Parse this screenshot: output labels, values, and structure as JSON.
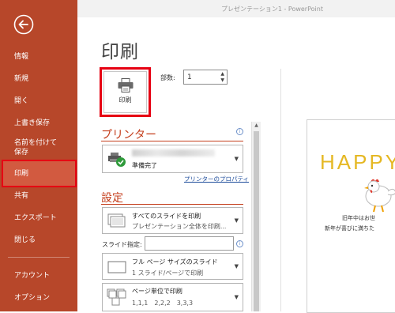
{
  "window": {
    "title": "プレゼンテーション1 - PowerPoint"
  },
  "sidebar": {
    "back_label": "戻る",
    "items": [
      {
        "label": "情報"
      },
      {
        "label": "新規"
      },
      {
        "label": "開く"
      },
      {
        "label": "上書き保存"
      },
      {
        "label": "名前を付けて\n保存"
      },
      {
        "label": "印刷",
        "selected": true
      },
      {
        "label": "共有"
      },
      {
        "label": "エクスポート"
      },
      {
        "label": "閉じる"
      },
      {
        "label": "アカウント"
      },
      {
        "label": "オプション"
      }
    ]
  },
  "page": {
    "title": "印刷"
  },
  "print_button": {
    "label": "印刷"
  },
  "copies": {
    "label": "部数:",
    "value": "1"
  },
  "printer": {
    "heading": "プリンター",
    "status": "準備完了",
    "properties_link": "プリンターのプロパティ"
  },
  "settings": {
    "heading": "設定",
    "range": {
      "line1": "すべてのスライドを印刷",
      "line2": "プレゼンテーション全体を印刷..."
    },
    "slides_label": "スライド指定:",
    "slides_value": "",
    "layout": {
      "line1": "フル ページ サイズのスライド",
      "line2": "1 スライド/ページで印刷"
    },
    "collate": {
      "line1": "ページ単位で印刷",
      "line2": "1,1,1　2,2,2　3,3,3"
    }
  },
  "preview": {
    "headline": "HAPPY",
    "line1": "旧年中はお世",
    "line2": "新年が喜びに満ちた"
  },
  "colors": {
    "sidebar": "#b7472a",
    "accent": "#c43e1c",
    "highlight_frame": "#e60012",
    "link": "#1f4e9c"
  }
}
